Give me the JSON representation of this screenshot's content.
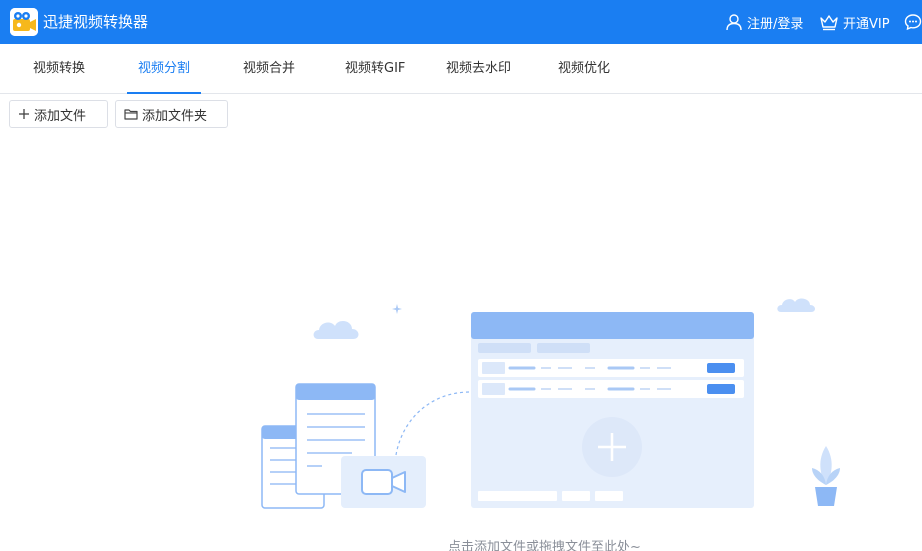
{
  "app": {
    "title": "迅捷视频转换器",
    "logo_icon": "video-camera-logo-icon",
    "brand_color": "#1a7ef2"
  },
  "header": {
    "login_label": "注册/登录",
    "login_icon": "user-icon",
    "vip_label": "开通VIP",
    "vip_icon": "crown-icon",
    "message_icon": "chat-bubble-icon"
  },
  "tabs": [
    {
      "label": "视频转换",
      "active": false
    },
    {
      "label": "视频分割",
      "active": true
    },
    {
      "label": "视频合并",
      "active": false
    },
    {
      "label": "视频转GIF",
      "active": false
    },
    {
      "label": "视频去水印",
      "active": false
    },
    {
      "label": "视频优化",
      "active": false
    }
  ],
  "toolbar": {
    "add_file_label": "添加文件",
    "add_file_icon": "plus-icon",
    "add_folder_label": "添加文件夹",
    "add_folder_icon": "folder-icon"
  },
  "empty_state": {
    "hint": "点击添加文件或拖拽文件至此处~"
  }
}
